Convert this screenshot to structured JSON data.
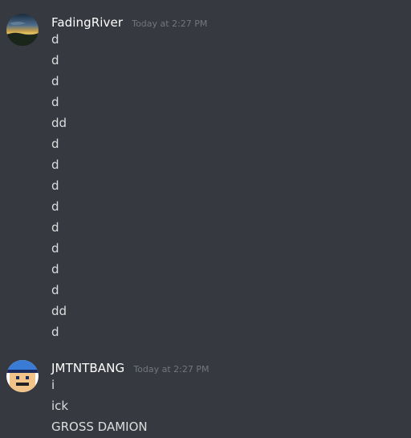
{
  "messages": [
    {
      "username": "FadingRiver",
      "timestamp": "Today at 2:27 PM",
      "avatar_icon": "sunset-landscape-avatar",
      "lines": [
        "d",
        "d",
        "d",
        "d",
        "dd",
        "d",
        "d",
        "d",
        "d",
        "d",
        "d",
        "d",
        "d",
        "dd",
        "d"
      ]
    },
    {
      "username": "JMTNTBANG",
      "timestamp": "Today at 2:27 PM",
      "avatar_icon": "pixel-face-avatar",
      "lines": [
        "i",
        "ick",
        "GROSS DAMION"
      ]
    }
  ],
  "colors": {
    "background": "#36393f",
    "username": "#ffffff",
    "timestamp": "#72767d",
    "message_text": "#dcddde"
  }
}
